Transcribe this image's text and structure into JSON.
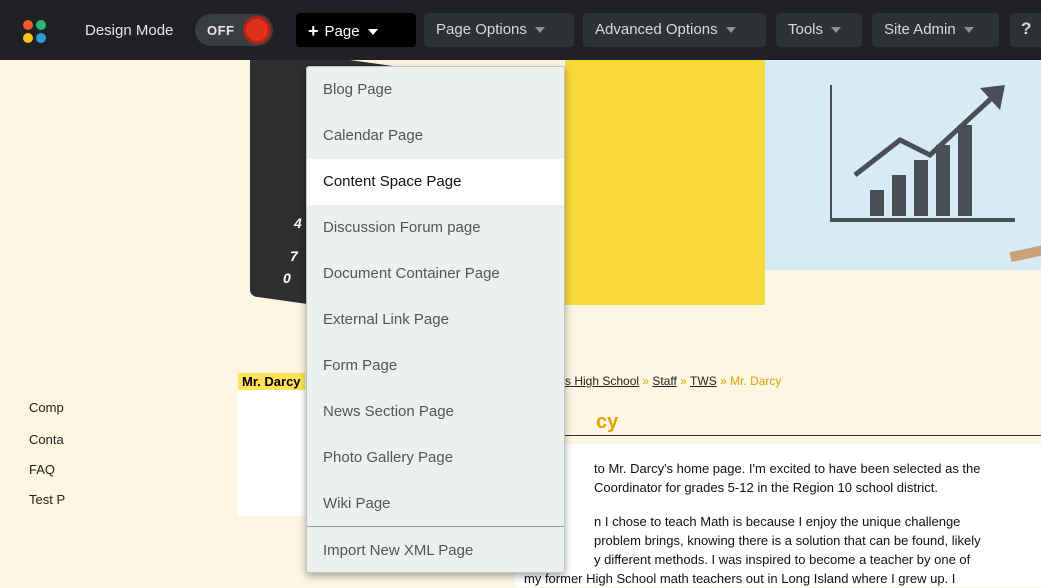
{
  "toolbar": {
    "design_mode_label": "Design Mode",
    "toggle_state": "OFF",
    "menus": {
      "page": "Page",
      "page_options": "Page Options",
      "advanced_options": "Advanced Options",
      "tools": "Tools",
      "site_admin": "Site Admin",
      "help": "?"
    }
  },
  "dropdown": {
    "items": [
      "Blog Page",
      "Calendar Page",
      "Content Space Page",
      "Discussion Forum page",
      "Document Container Page",
      "External Link Page",
      "Form Page",
      "News Section Page",
      "Photo Gallery Page",
      "Wiki Page"
    ],
    "import": "Import New XML Page",
    "highlighted": "Content Space Page"
  },
  "calculator_keys": [
    "4",
    "7",
    "0"
  ],
  "sidebar": {
    "title": "Mr. Darcy",
    "items": [
      "Comp",
      "Conta",
      "FAQ",
      "Test P"
    ]
  },
  "breadcrumb": {
    "school": "s High School",
    "staff": "Staff",
    "tws": "TWS",
    "current": "Mr. Darcy",
    "sep": "»"
  },
  "page_title": "cy",
  "content": {
    "lines": [
      "to Mr. Darcy's home page. I'm excited to have been selected as the",
      "Coordinator for grades 5-12 in the Region 10 school district.",
      "n I chose to teach Math is because I enjoy the unique challenge",
      "problem brings, knowing there is a solution that can be found, likely",
      "y different methods. I was inspired to become a teacher by one of",
      "my former High School math teachers out in Long Island where I grew up. I"
    ]
  },
  "colors": {
    "toolbar_bg": "#1f2124",
    "accent_yellow": "#e0a400",
    "toggle_red": "#e0301e"
  }
}
